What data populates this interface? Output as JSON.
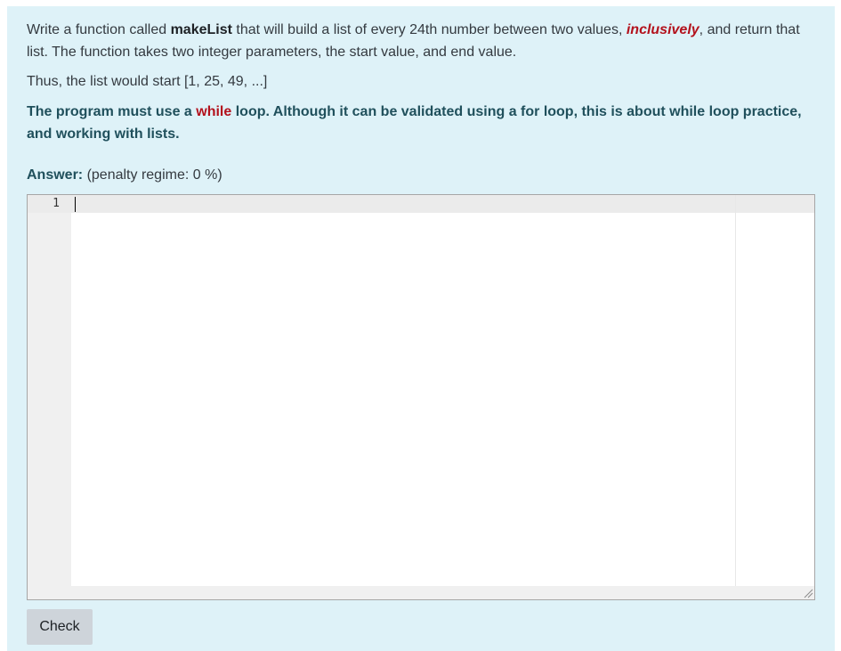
{
  "question": {
    "p1_a": "Write a function called ",
    "p1_func": "makeList",
    "p1_b": " that will build a list of every 24th number between two values, ",
    "p1_emph": "inclusively",
    "p1_c": ", and return that list.  The function takes two integer parameters, the start value, and end value.",
    "p2": "Thus, the list would start [1, 25, 49, ...]",
    "p3_a": "The program must use a ",
    "p3_while": "while",
    "p3_b": " loop.  Although it can be validated using a for loop, this is about while loop practice, and working with lists."
  },
  "answer": {
    "label": "Answer:",
    "penalty": "(penalty regime: 0 %)"
  },
  "editor": {
    "line_numbers": [
      "1"
    ],
    "code": ""
  },
  "check_button": {
    "label": "Check"
  },
  "colors": {
    "panel_bg": "#def2f8",
    "accent_red": "#b3121d",
    "heading_teal": "#20505c",
    "button_bg": "#ced4da"
  }
}
